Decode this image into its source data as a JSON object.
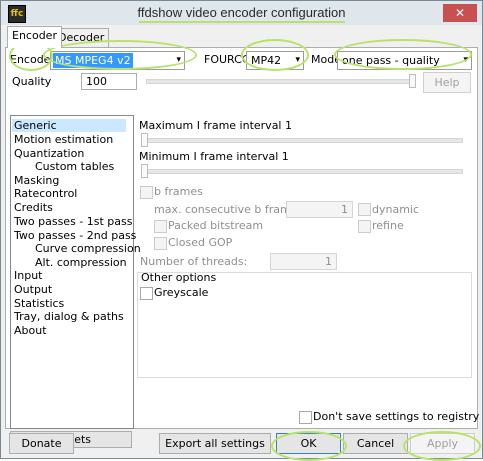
{
  "window": {
    "title": "ffdshow video encoder configuration",
    "icon_text": "ffc",
    "close_glyph": "✕"
  },
  "tabs": [
    {
      "label": "Encoder",
      "active": true
    },
    {
      "label": "Decoder",
      "active": false
    }
  ],
  "encoder_row": {
    "encoder_label": "Encoder:",
    "encoder_value": "MS MPEG4 v2",
    "fourcc_label": "FOURCC",
    "fourcc_value": "MP42",
    "mode_label": "Mode",
    "mode_value": "one pass - quality",
    "arrow_glyph": "▾"
  },
  "quality": {
    "label": "Quality",
    "value": "100",
    "help_label": "Help",
    "slider_level": 1.0
  },
  "page_list": {
    "items": [
      {
        "label": "Generic",
        "selected": true,
        "level": 0
      },
      {
        "label": "Motion estimation",
        "selected": false,
        "level": 0
      },
      {
        "label": "Quantization",
        "selected": false,
        "level": 0
      },
      {
        "label": "Custom tables",
        "selected": false,
        "level": 1
      },
      {
        "label": "Masking",
        "selected": false,
        "level": 0
      },
      {
        "label": "Ratecontrol",
        "selected": false,
        "level": 0
      },
      {
        "label": "Credits",
        "selected": false,
        "level": 0
      },
      {
        "label": "Two passes - 1st pass",
        "selected": false,
        "level": 0
      },
      {
        "label": "Two passes - 2nd pass",
        "selected": false,
        "level": 0
      },
      {
        "label": "Curve compression",
        "selected": false,
        "level": 1
      },
      {
        "label": "Alt. compression",
        "selected": false,
        "level": 1
      },
      {
        "label": "Input",
        "selected": false,
        "level": 0
      },
      {
        "label": "Output",
        "selected": false,
        "level": 0
      },
      {
        "label": "Statistics",
        "selected": false,
        "level": 0
      },
      {
        "label": "Tray, dialog & paths",
        "selected": false,
        "level": 0
      },
      {
        "label": "About",
        "selected": false,
        "level": 0
      }
    ],
    "presets_label": "Presets"
  },
  "generic": {
    "max_i_interval_label": "Maximum I frame interval 1",
    "min_i_interval_label": "Minimum I frame interval 1",
    "b_frames_label": "b frames",
    "max_consecutive_label": "max. consecutive b frames:",
    "max_consecutive_value": "1",
    "dynamic_label": "dynamic",
    "packed_bitstream_label": "Packed bitstream",
    "refine_label": "refine",
    "closed_gop_label": "Closed GOP",
    "threads_label": "Number of threads:",
    "threads_value": "1",
    "other_options_label": "Other options",
    "greyscale_label": "Greyscale"
  },
  "footer": {
    "dont_save_label": "Don't save settings to registry",
    "donate_label": "Donate",
    "export_label": "Export all settings",
    "ok_label": "OK",
    "cancel_label": "Cancel",
    "apply_label": "Apply"
  },
  "colors": {
    "highlight_annotation": "#b7e26b",
    "selection_blue": "#3399ff",
    "list_selection": "#cce8ff",
    "close_button": "#c75050"
  }
}
